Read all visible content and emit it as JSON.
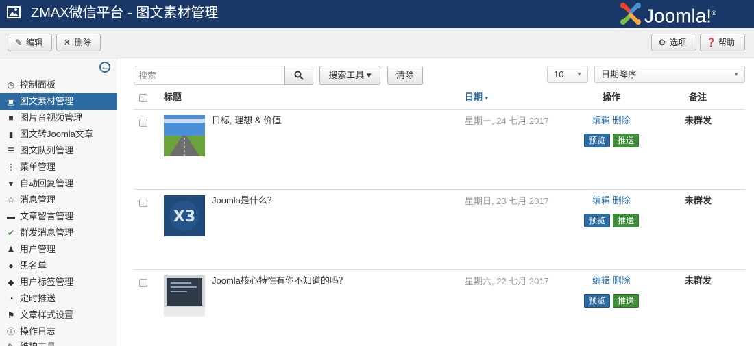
{
  "header": {
    "title": "ZMAX微信平台 - 图文素材管理",
    "logo_text": "Joomla!",
    "logo_reg": "®",
    "brand_color": "#1a3867"
  },
  "toolbar": {
    "edit_label": "编辑",
    "edit_icon": "edit-icon",
    "delete_label": "删除",
    "delete_icon": "close-icon",
    "options_label": "选项",
    "options_icon": "gear-icon",
    "help_label": "帮助",
    "help_icon": "question-icon"
  },
  "sidebar": {
    "items": [
      {
        "label": "控制面板",
        "icon": "dashboard-icon"
      },
      {
        "label": "图文素材管理",
        "icon": "image-icon",
        "active": true
      },
      {
        "label": "图片音视频管理",
        "icon": "video-icon"
      },
      {
        "label": "图文转Joomla文章",
        "icon": "book-icon"
      },
      {
        "label": "图文队列管理",
        "icon": "list-icon"
      },
      {
        "label": "菜单管理",
        "icon": "menu-dots-icon"
      },
      {
        "label": "自动回复管理",
        "icon": "filter-icon"
      },
      {
        "label": "消息管理",
        "icon": "star-icon"
      },
      {
        "label": "文章留言管理",
        "icon": "comment-icon"
      },
      {
        "label": "群发消息管理",
        "icon": "check-icon"
      },
      {
        "label": "用户管理",
        "icon": "user-icon"
      },
      {
        "label": "黑名单",
        "icon": "circle-icon"
      },
      {
        "label": "用户标签管理",
        "icon": "tag-icon"
      },
      {
        "label": "定时推送",
        "icon": "clock-icon"
      },
      {
        "label": "文章样式设置",
        "icon": "flag-icon"
      },
      {
        "label": "操作日志",
        "icon": "info-icon"
      },
      {
        "label": "维护工具",
        "icon": "wrench-icon"
      }
    ]
  },
  "filters": {
    "search_placeholder": "搜索",
    "search_tools_label": "搜索工具 ▾",
    "clear_label": "清除",
    "limit_value": "10",
    "sort_value": "日期降序"
  },
  "table": {
    "columns": {
      "title": "标题",
      "date": "日期",
      "date_sort_indicator": "▾",
      "action": "操作",
      "note": "备注"
    },
    "rows": [
      {
        "title": "目标, 理想 & 价值",
        "date": "星期一, 24 七月 2017",
        "edit": "编辑",
        "delete": "删除",
        "preview": "预览",
        "push": "推送",
        "note": "未群发",
        "thumb": "road-landscape"
      },
      {
        "title": "Joomla是什么？",
        "date": "星期日, 23 七月 2017",
        "edit": "编辑",
        "delete": "删除",
        "preview": "预览",
        "push": "推送",
        "note": "未群发",
        "thumb": "joomla-x3-logo"
      },
      {
        "title": "Joomla核心特性有你不知道的吗？",
        "date": "星期六, 22 七月 2017",
        "edit": "编辑",
        "delete": "删除",
        "preview": "预览",
        "push": "推送",
        "note": "未群发",
        "thumb": "presentation-screen"
      }
    ]
  }
}
